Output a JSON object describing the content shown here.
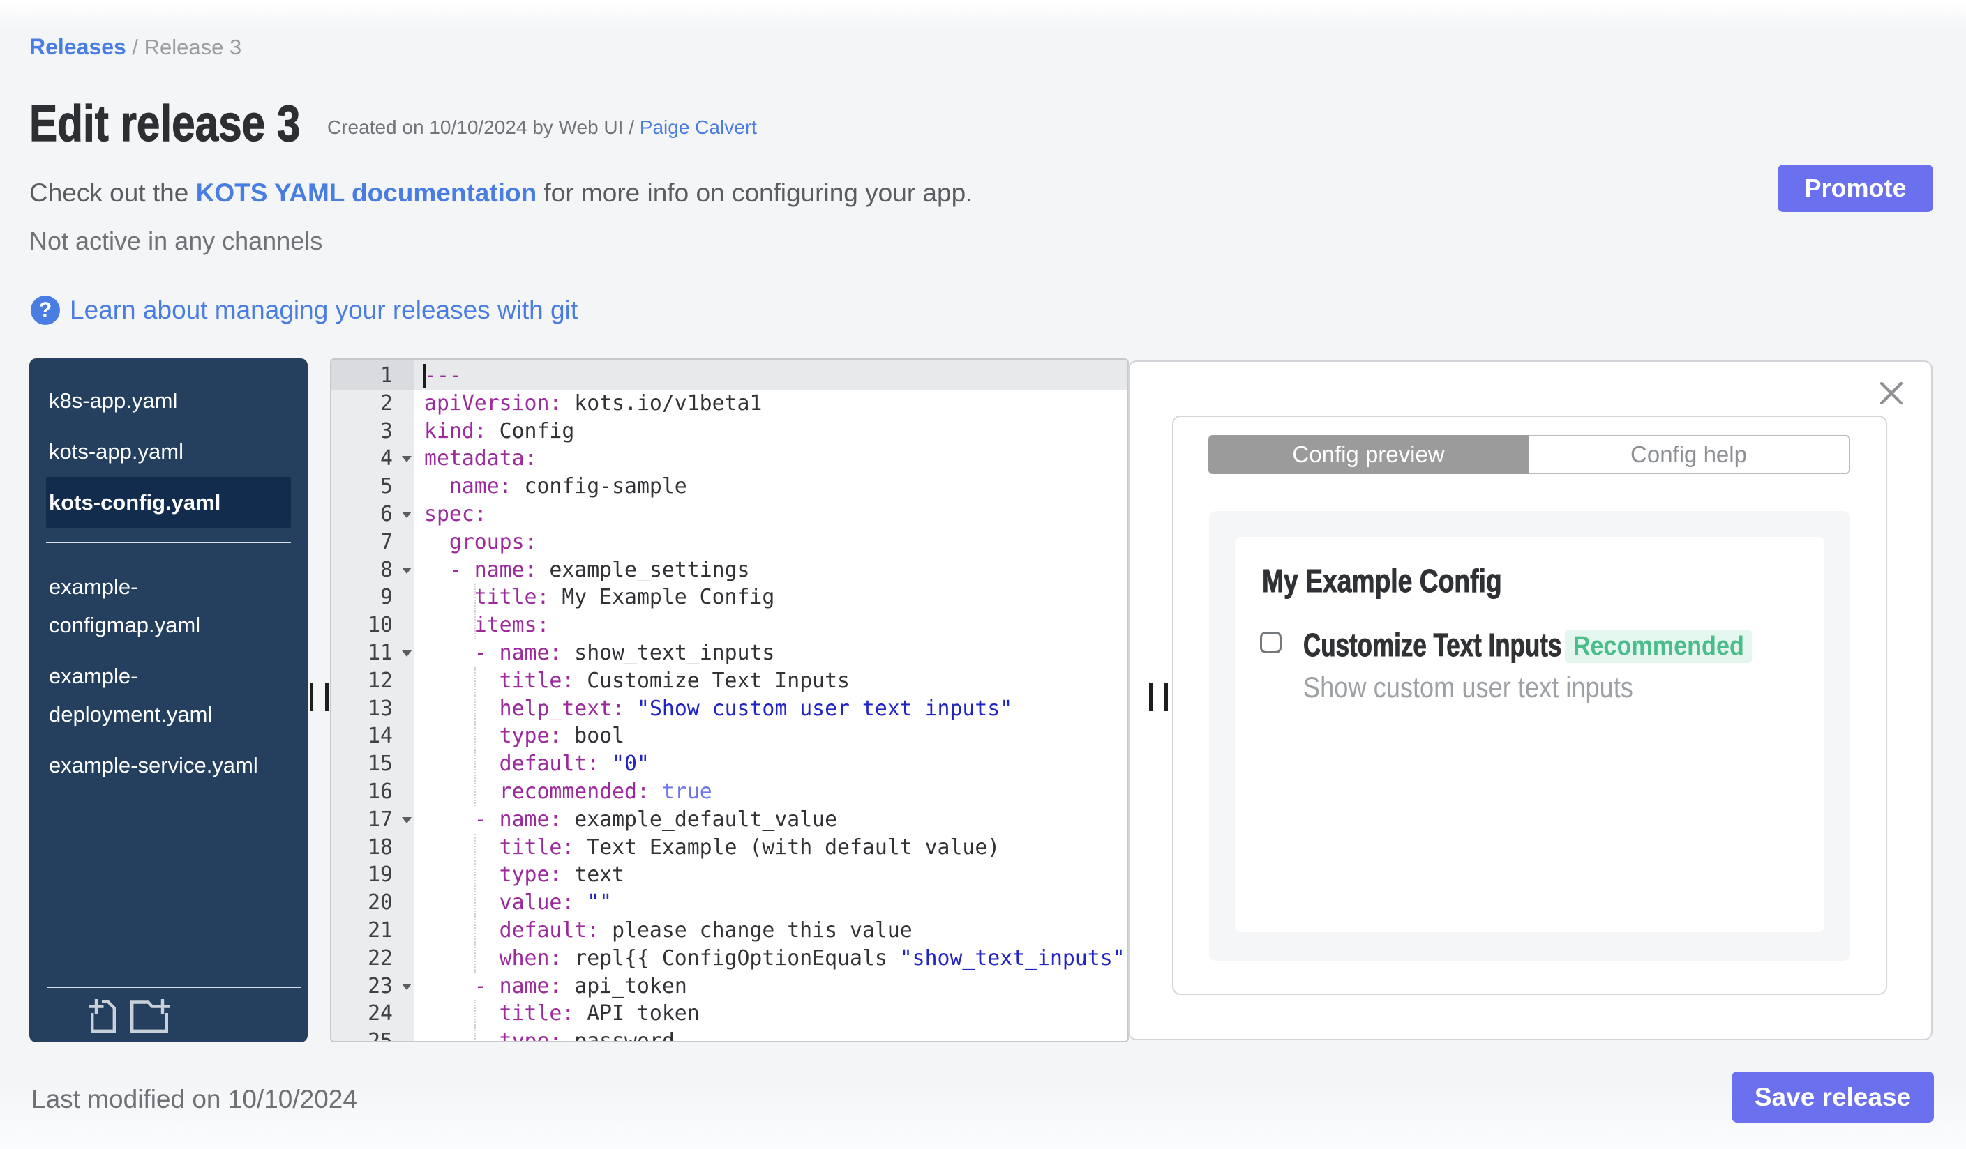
{
  "breadcrumb": {
    "link": "Releases",
    "separator": "/",
    "current": "Release 3"
  },
  "header": {
    "title": "Edit release 3",
    "created_prefix": "Created on 10/10/2024 by Web UI / ",
    "created_link": "Paige Calvert",
    "promote_label": "Promote"
  },
  "info": {
    "check_prefix": "Check out the ",
    "check_link": "KOTS YAML documentation",
    "check_suffix": " for more info on configuring your app.",
    "not_active": "Not active in any channels",
    "help_icon": "?",
    "learn_link": "Learn about managing your releases with git"
  },
  "sidebar": {
    "files": [
      {
        "name": "k8s-app.yaml",
        "selected": false,
        "group": 1
      },
      {
        "name": "kots-app.yaml",
        "selected": false,
        "group": 1
      },
      {
        "name": "kots-config.yaml",
        "selected": true,
        "group": 1
      },
      {
        "name": "example-configmap.yaml",
        "selected": false,
        "group": 2
      },
      {
        "name": "example-deployment.yaml",
        "selected": false,
        "group": 2
      },
      {
        "name": "example-service.yaml",
        "selected": false,
        "group": 2
      }
    ],
    "icons": [
      "new-file-icon",
      "new-folder-icon"
    ]
  },
  "editor": {
    "active_line": 1,
    "cursor_line": 1,
    "fold_lines": [
      4,
      6,
      8,
      11,
      17,
      23
    ],
    "guide_lines": [
      9,
      10,
      12,
      13,
      14,
      15,
      16,
      18,
      19,
      20,
      21,
      22,
      24,
      25
    ],
    "lines": [
      {
        "n": 1,
        "tokens": [
          [
            "key",
            "---"
          ]
        ]
      },
      {
        "n": 2,
        "tokens": [
          [
            "key",
            "apiVersion:"
          ],
          [
            "txt",
            " kots.io/v1beta1"
          ]
        ]
      },
      {
        "n": 3,
        "tokens": [
          [
            "key",
            "kind:"
          ],
          [
            "txt",
            " Config"
          ]
        ]
      },
      {
        "n": 4,
        "tokens": [
          [
            "key",
            "metadata:"
          ]
        ]
      },
      {
        "n": 5,
        "tokens": [
          [
            "txt",
            "  "
          ],
          [
            "key",
            "name:"
          ],
          [
            "txt",
            " config-sample"
          ]
        ]
      },
      {
        "n": 6,
        "tokens": [
          [
            "key",
            "spec:"
          ]
        ]
      },
      {
        "n": 7,
        "tokens": [
          [
            "txt",
            "  "
          ],
          [
            "key",
            "groups:"
          ]
        ]
      },
      {
        "n": 8,
        "tokens": [
          [
            "txt",
            "  "
          ],
          [
            "dash",
            "- "
          ],
          [
            "key",
            "name:"
          ],
          [
            "txt",
            " example_settings"
          ]
        ]
      },
      {
        "n": 9,
        "tokens": [
          [
            "txt",
            "    "
          ],
          [
            "key",
            "title:"
          ],
          [
            "txt",
            " My Example Config"
          ]
        ]
      },
      {
        "n": 10,
        "tokens": [
          [
            "txt",
            "    "
          ],
          [
            "key",
            "items:"
          ]
        ]
      },
      {
        "n": 11,
        "tokens": [
          [
            "txt",
            "    "
          ],
          [
            "dash",
            "- "
          ],
          [
            "key",
            "name:"
          ],
          [
            "txt",
            " show_text_inputs"
          ]
        ]
      },
      {
        "n": 12,
        "tokens": [
          [
            "txt",
            "      "
          ],
          [
            "key",
            "title:"
          ],
          [
            "txt",
            " Customize Text Inputs"
          ]
        ]
      },
      {
        "n": 13,
        "tokens": [
          [
            "txt",
            "      "
          ],
          [
            "key",
            "help_text:"
          ],
          [
            "txt",
            " "
          ],
          [
            "str",
            "\"Show custom user text inputs\""
          ]
        ]
      },
      {
        "n": 14,
        "tokens": [
          [
            "txt",
            "      "
          ],
          [
            "key",
            "type:"
          ],
          [
            "txt",
            " bool"
          ]
        ]
      },
      {
        "n": 15,
        "tokens": [
          [
            "txt",
            "      "
          ],
          [
            "key",
            "default:"
          ],
          [
            "txt",
            " "
          ],
          [
            "str",
            "\"0\""
          ]
        ]
      },
      {
        "n": 16,
        "tokens": [
          [
            "txt",
            "      "
          ],
          [
            "key",
            "recommended:"
          ],
          [
            "txt",
            " "
          ],
          [
            "bool",
            "true"
          ]
        ]
      },
      {
        "n": 17,
        "tokens": [
          [
            "txt",
            "    "
          ],
          [
            "dash",
            "- "
          ],
          [
            "key",
            "name:"
          ],
          [
            "txt",
            " example_default_value"
          ]
        ]
      },
      {
        "n": 18,
        "tokens": [
          [
            "txt",
            "      "
          ],
          [
            "key",
            "title:"
          ],
          [
            "txt",
            " Text Example (with default value)"
          ]
        ]
      },
      {
        "n": 19,
        "tokens": [
          [
            "txt",
            "      "
          ],
          [
            "key",
            "type:"
          ],
          [
            "txt",
            " text"
          ]
        ]
      },
      {
        "n": 20,
        "tokens": [
          [
            "txt",
            "      "
          ],
          [
            "key",
            "value:"
          ],
          [
            "txt",
            " "
          ],
          [
            "str",
            "\"\""
          ]
        ]
      },
      {
        "n": 21,
        "tokens": [
          [
            "txt",
            "      "
          ],
          [
            "key",
            "default:"
          ],
          [
            "txt",
            " please change this value"
          ]
        ]
      },
      {
        "n": 22,
        "tokens": [
          [
            "txt",
            "      "
          ],
          [
            "key",
            "when:"
          ],
          [
            "txt",
            " repl{{ ConfigOptionEquals "
          ],
          [
            "str",
            "\"show_text_inputs\""
          ]
        ]
      },
      {
        "n": 23,
        "tokens": [
          [
            "txt",
            "    "
          ],
          [
            "dash",
            "- "
          ],
          [
            "key",
            "name:"
          ],
          [
            "txt",
            " api_token"
          ]
        ]
      },
      {
        "n": 24,
        "tokens": [
          [
            "txt",
            "      "
          ],
          [
            "key",
            "title:"
          ],
          [
            "txt",
            " API token"
          ]
        ]
      },
      {
        "n": 25,
        "tokens": [
          [
            "txt",
            "      "
          ],
          [
            "key",
            "type:"
          ],
          [
            "txt",
            " password"
          ]
        ]
      }
    ]
  },
  "preview": {
    "close_icon": "close-icon",
    "tabs": [
      {
        "label": "Config preview",
        "active": true
      },
      {
        "label": "Config help",
        "active": false
      }
    ],
    "config": {
      "title": "My Example Config",
      "checkbox_label": "Customize Text Inputs",
      "badge": "Recommended",
      "help_text": "Show custom user text inputs"
    }
  },
  "footer": {
    "last_modified": "Last modified on 10/10/2024",
    "save_label": "Save release"
  },
  "colors": {
    "accent_blue": "#4a7de1",
    "button_indigo": "#6b70ee",
    "sidebar_navy": "#24405e",
    "sidebar_selected": "#122c4d",
    "badge_green_bg": "#e3f6ec",
    "badge_green_text": "#47bd8a",
    "yaml_key": "#a325a3",
    "yaml_string": "#2328d2",
    "yaml_bool": "#6d76ec"
  }
}
